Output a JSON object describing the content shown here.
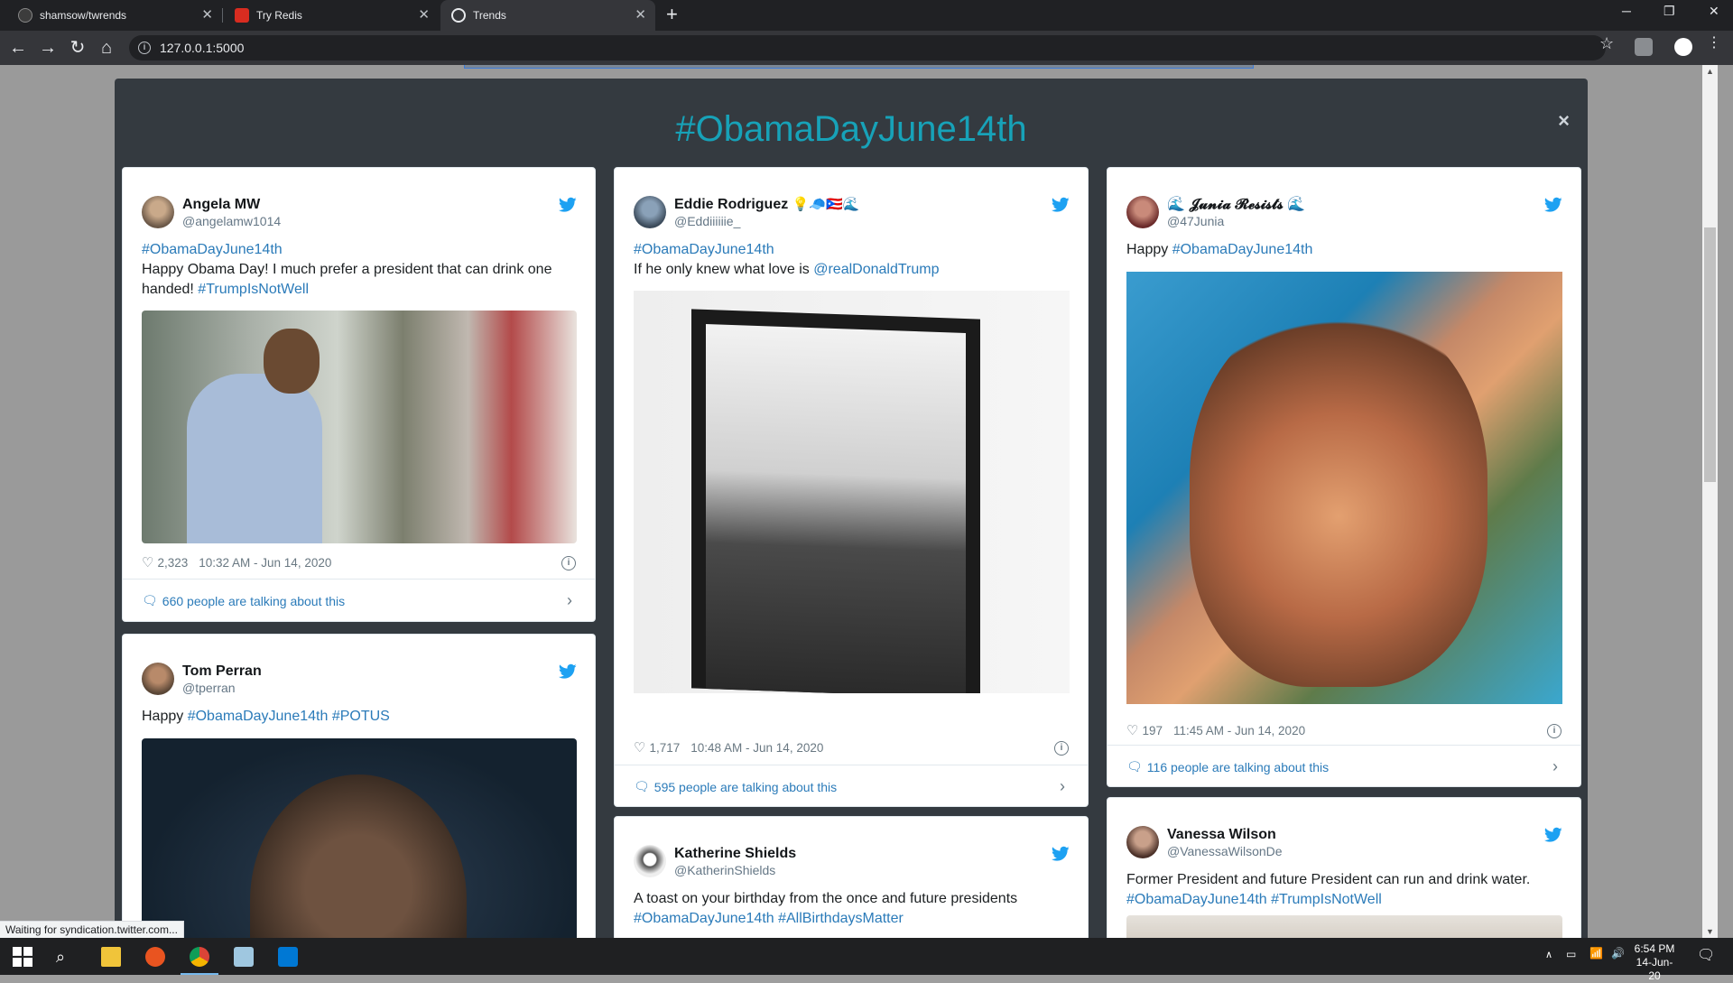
{
  "browser": {
    "tabs": [
      {
        "title": "shamsow/twrends",
        "active": false
      },
      {
        "title": "Try Redis",
        "active": false
      },
      {
        "title": "Trends",
        "active": true
      }
    ],
    "url": "127.0.0.1:5000"
  },
  "modal": {
    "title": "#ObamaDayJune14th",
    "close": "×"
  },
  "tweets": [
    {
      "name": "Angela MW",
      "handle": "@angelamw1014",
      "line1": "#ObamaDayJune14th",
      "text": "Happy Obama Day! I much prefer a president that can drink one handed!",
      "tag": "#TrumpIsNotWell",
      "likes": "2,323",
      "time": "10:32 AM - Jun 14, 2020",
      "talking": "660 people are talking about this"
    },
    {
      "name": "Tom Perran",
      "handle": "@tperran",
      "text": "Happy",
      "tag1": "#ObamaDayJune14th",
      "tag2": "#POTUS"
    },
    {
      "name": "Eddie Rodriguez",
      "emoji": "💡🧢🇵🇷🌊",
      "handle": "@Eddiiiiiie_",
      "line1": "#ObamaDayJune14th",
      "text": "If he only knew what love is",
      "mention": "@realDonaldTrump",
      "likes": "1,717",
      "time": "10:48 AM - Jun 14, 2020",
      "talking": "595 people are talking about this"
    },
    {
      "name": "Katherine Shields",
      "handle": "@KatherinShields",
      "text": "A toast on your birthday from the once and future presidents",
      "tag1": "#ObamaDayJune14th",
      "tag2": "#AllBirthdaysMatter"
    },
    {
      "name": "𝓙𝓾𝓷𝓲𝓪 𝓡𝓮𝓼𝓲𝓼𝓽𝓼",
      "emoji_l": "🌊",
      "emoji_r": "🌊",
      "handle": "@47Junia",
      "text": "Happy",
      "tag": "#ObamaDayJune14th",
      "likes": "197",
      "time": "11:45 AM - Jun 14, 2020",
      "talking": "116 people are talking about this"
    },
    {
      "name": "Vanessa Wilson",
      "handle": "@VanessaWilsonDe",
      "text": "Former President and future President can run and drink water.",
      "tag1": "#ObamaDayJune14th",
      "tag2": "#TrumpIsNotWell"
    }
  ],
  "status_bar": "Waiting for syndication.twitter.com...",
  "taskbar": {
    "time": "6:54 PM",
    "date": "14-Jun-20"
  },
  "colors": {
    "modal_bg": "#343a40",
    "title": "#17a2b8",
    "link": "#2b7bb9"
  }
}
